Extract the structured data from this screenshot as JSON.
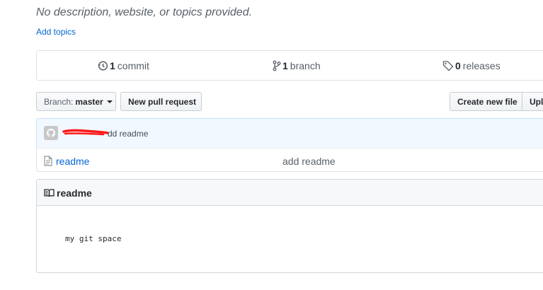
{
  "repo": {
    "description": "No description, website, or topics provided.",
    "add_topics": "Add topics"
  },
  "numbers": {
    "commits_count": "1",
    "commits_label": "commit",
    "branches_count": "1",
    "branches_label": "branch",
    "releases_count": "0",
    "releases_label": "releases"
  },
  "toolbar": {
    "branch_prefix": "Branch:",
    "branch_value": "master",
    "new_pull_request": "New pull request",
    "create_new_file": "Create new file",
    "upload_files": "Upl"
  },
  "latest_commit": {
    "message": "dd readme"
  },
  "files": [
    {
      "name": "readme",
      "commit_message": "add readme",
      "icon": "file-icon"
    }
  ],
  "readme": {
    "title": "readme",
    "content": "my git space"
  },
  "colors": {
    "link": "#0366d6",
    "commit_bar_bg": "#f1f8ff",
    "redaction": "#ff1a1a"
  }
}
